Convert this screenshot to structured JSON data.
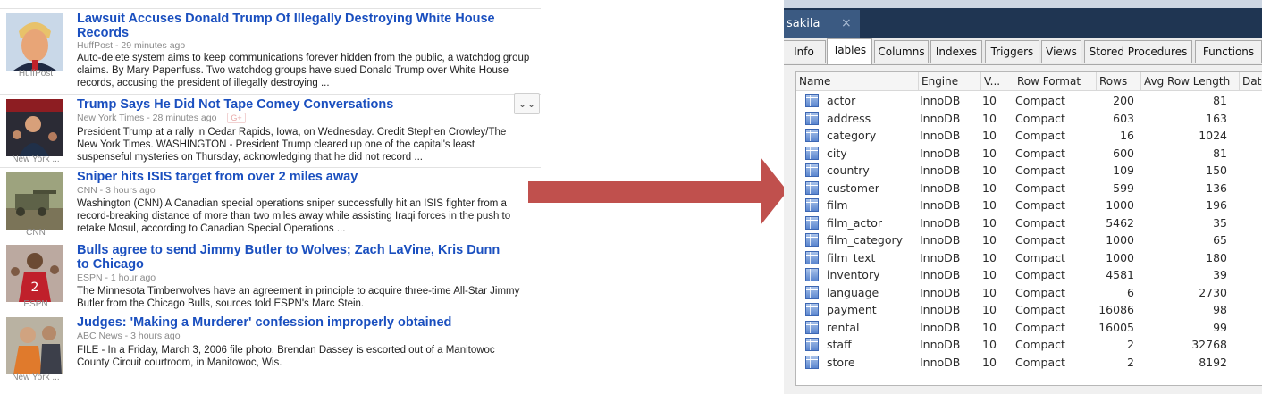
{
  "news": {
    "stories": [
      {
        "source_label": "HuffPost",
        "title": "Lawsuit Accuses Donald Trump Of Illegally Destroying White House Records",
        "meta": "HuffPost - 29 minutes ago",
        "snippet": "Auto-delete system aims to keep communications forever hidden from the public, a watchdog group claims. By Mary Papenfuss. Two watchdog groups have sued Donald Trump over White House records, accusing the president of illegally destroying ..."
      },
      {
        "source_label": "New York ...",
        "title": "Trump Says He Did Not Tape Comey Conversations",
        "meta": "New York Times - 28 minutes ago",
        "snippet": "President Trump at a rally in Cedar Rapids, Iowa, on Wednesday. Credit Stephen Crowley/The New York Times. WASHINGTON - President Trump cleared up one of the capital's least suspenseful mysteries on Thursday, acknowledging that he did not record ..."
      },
      {
        "source_label": "CNN",
        "title": "Sniper hits ISIS target from over 2 miles away",
        "meta": "CNN - 3 hours ago",
        "snippet": "Washington (CNN) A Canadian special operations sniper successfully hit an ISIS fighter from a record-breaking distance of more than two miles away while assisting Iraqi forces in the push to retake Mosul, according to Canadian Special Operations ..."
      },
      {
        "source_label": "ESPN",
        "title": "Bulls agree to send Jimmy Butler to Wolves; Zach LaVine, Kris Dunn to Chicago",
        "meta": "ESPN - 1 hour ago",
        "snippet": "The Minnesota Timberwolves have an agreement in principle to acquire three-time All-Star Jimmy Butler from the Chicago Bulls, sources told ESPN's Marc Stein."
      },
      {
        "source_label": "New York ...",
        "title": "Judges: 'Making a Murderer' confession improperly obtained",
        "meta": "ABC News - 3 hours ago",
        "snippet": "FILE - In a Friday, March 3, 2006 file photo, Brendan Dassey is escorted out of a Manitowoc County Circuit courtroom, in Manitowoc, Wis."
      }
    ],
    "gplus_label": "G+",
    "expand_icon": "double-chevron-down-icon",
    "expand_glyph": "⌄⌄"
  },
  "arrow": {
    "color": "#c0504d"
  },
  "db": {
    "connection_tab": "sakila",
    "close_glyph": "×",
    "tabs": [
      "Info",
      "Tables",
      "Columns",
      "Indexes",
      "Triggers",
      "Views",
      "Stored Procedures",
      "Functions"
    ],
    "active_tab": "Tables",
    "columns": [
      "Name",
      "Engine",
      "V...",
      "Row Format",
      "Rows",
      "Avg Row Length",
      "Dat"
    ],
    "rows": [
      {
        "name": "actor",
        "engine": "InnoDB",
        "version": "10",
        "row_format": "Compact",
        "rows": "200",
        "avg_row_length": "81"
      },
      {
        "name": "address",
        "engine": "InnoDB",
        "version": "10",
        "row_format": "Compact",
        "rows": "603",
        "avg_row_length": "163"
      },
      {
        "name": "category",
        "engine": "InnoDB",
        "version": "10",
        "row_format": "Compact",
        "rows": "16",
        "avg_row_length": "1024"
      },
      {
        "name": "city",
        "engine": "InnoDB",
        "version": "10",
        "row_format": "Compact",
        "rows": "600",
        "avg_row_length": "81"
      },
      {
        "name": "country",
        "engine": "InnoDB",
        "version": "10",
        "row_format": "Compact",
        "rows": "109",
        "avg_row_length": "150"
      },
      {
        "name": "customer",
        "engine": "InnoDB",
        "version": "10",
        "row_format": "Compact",
        "rows": "599",
        "avg_row_length": "136"
      },
      {
        "name": "film",
        "engine": "InnoDB",
        "version": "10",
        "row_format": "Compact",
        "rows": "1000",
        "avg_row_length": "196"
      },
      {
        "name": "film_actor",
        "engine": "InnoDB",
        "version": "10",
        "row_format": "Compact",
        "rows": "5462",
        "avg_row_length": "35"
      },
      {
        "name": "film_category",
        "engine": "InnoDB",
        "version": "10",
        "row_format": "Compact",
        "rows": "1000",
        "avg_row_length": "65"
      },
      {
        "name": "film_text",
        "engine": "InnoDB",
        "version": "10",
        "row_format": "Compact",
        "rows": "1000",
        "avg_row_length": "180"
      },
      {
        "name": "inventory",
        "engine": "InnoDB",
        "version": "10",
        "row_format": "Compact",
        "rows": "4581",
        "avg_row_length": "39"
      },
      {
        "name": "language",
        "engine": "InnoDB",
        "version": "10",
        "row_format": "Compact",
        "rows": "6",
        "avg_row_length": "2730"
      },
      {
        "name": "payment",
        "engine": "InnoDB",
        "version": "10",
        "row_format": "Compact",
        "rows": "16086",
        "avg_row_length": "98"
      },
      {
        "name": "rental",
        "engine": "InnoDB",
        "version": "10",
        "row_format": "Compact",
        "rows": "16005",
        "avg_row_length": "99"
      },
      {
        "name": "staff",
        "engine": "InnoDB",
        "version": "10",
        "row_format": "Compact",
        "rows": "2",
        "avg_row_length": "32768"
      },
      {
        "name": "store",
        "engine": "InnoDB",
        "version": "10",
        "row_format": "Compact",
        "rows": "2",
        "avg_row_length": "8192"
      }
    ]
  }
}
